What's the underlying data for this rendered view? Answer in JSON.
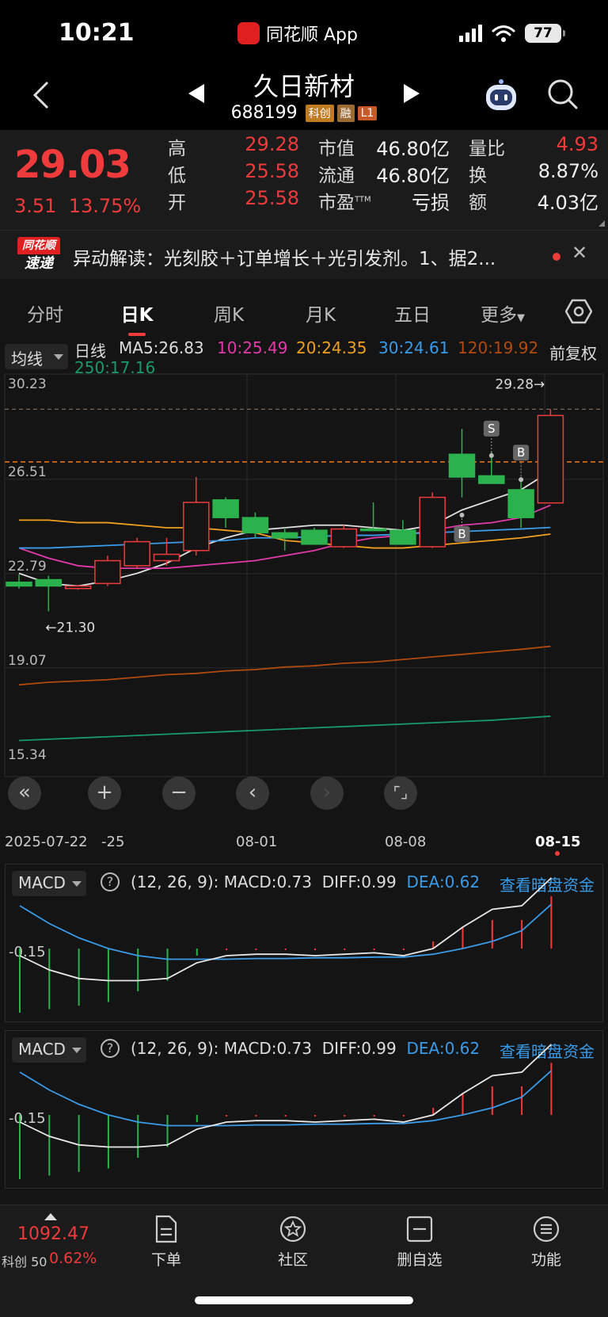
{
  "status_bar": {
    "time": "10:21",
    "app_name": "同花顺 App",
    "battery": "77"
  },
  "header": {
    "stock_name": "久日新材",
    "stock_code": "688199",
    "tags": [
      "科创",
      "融",
      "L1"
    ],
    "icons": [
      "back-icon",
      "prev-arrow-icon",
      "next-arrow-icon",
      "robot-assistant-icon",
      "search-icon"
    ]
  },
  "quote": {
    "price": "29.03",
    "change": "3.51",
    "change_pct": "13.75%",
    "high_label": "高",
    "high": "29.28",
    "low_label": "低",
    "low": "25.58",
    "open_label": "开",
    "open": "25.58",
    "mktcap_label": "市值",
    "mktcap": "46.80亿",
    "float_label": "流通",
    "float_cap": "46.80亿",
    "pe_label": "市盈",
    "pe_sup": "TTM",
    "pe": "亏损",
    "vol_ratio_label": "量比",
    "vol_ratio": "4.93",
    "turnover_label": "换",
    "turnover": "8.87%",
    "amount_label": "额",
    "amount": "4.03亿"
  },
  "news": {
    "logo_top": "同花顺",
    "logo_bottom": "速递",
    "text": "异动解读：光刻胶＋订单增长＋光引发剂。1、据2..."
  },
  "tabs": [
    "分时",
    "日K",
    "周K",
    "月K",
    "五日",
    "更多"
  ],
  "active_tab": 1,
  "chart_header": {
    "ma_select": "均线",
    "period": "日线",
    "ma5": "MA5:26.83",
    "ma10": "10:25.49",
    "ma20": "20:24.35",
    "ma30": "30:24.61",
    "ma120": "120:19.92",
    "ma250": "250:17.16",
    "adjust": "前复权"
  },
  "colors": {
    "up": "#ef3b3b",
    "down": "#2bb24c",
    "ma5": "#e0e0e0",
    "ma10": "#e23aa8",
    "ma20": "#f0a020",
    "ma30": "#3a9be8",
    "ma120": "#b04a10",
    "ma250": "#1a9a6a"
  },
  "chart_data": {
    "type": "candlestick",
    "y_ticks": [
      "30.23",
      "26.51",
      "22.79",
      "19.07",
      "15.34"
    ],
    "ylim": [
      15.34,
      30.23
    ],
    "x_labels": [
      "2025-07-22",
      "-25",
      "08-01",
      "08-08",
      "08-15"
    ],
    "annotations": {
      "high": "29.28→",
      "low": "←21.30"
    },
    "signal_marks": [
      "S",
      "B",
      "B"
    ],
    "candles": [
      {
        "o": 22.45,
        "h": 22.75,
        "l": 22.2,
        "c": 22.3
      },
      {
        "o": 22.55,
        "h": 22.7,
        "l": 21.3,
        "c": 22.3
      },
      {
        "o": 22.2,
        "h": 22.35,
        "l": 22.15,
        "c": 22.3
      },
      {
        "o": 22.4,
        "h": 23.5,
        "l": 22.3,
        "c": 23.3
      },
      {
        "o": 23.1,
        "h": 24.2,
        "l": 23.0,
        "c": 24.05
      },
      {
        "o": 23.3,
        "h": 24.2,
        "l": 23.1,
        "c": 23.55
      },
      {
        "o": 23.7,
        "h": 26.6,
        "l": 23.5,
        "c": 25.6
      },
      {
        "o": 25.7,
        "h": 25.8,
        "l": 24.6,
        "c": 25.0
      },
      {
        "o": 25.0,
        "h": 25.2,
        "l": 24.2,
        "c": 24.4
      },
      {
        "o": 24.4,
        "h": 24.6,
        "l": 23.7,
        "c": 24.2
      },
      {
        "o": 24.5,
        "h": 24.6,
        "l": 24.0,
        "c": 23.95
      },
      {
        "o": 23.85,
        "h": 24.7,
        "l": 23.8,
        "c": 24.55
      },
      {
        "o": 24.55,
        "h": 25.6,
        "l": 24.5,
        "c": 24.5
      },
      {
        "o": 24.5,
        "h": 24.9,
        "l": 24.1,
        "c": 23.95
      },
      {
        "o": 23.85,
        "h": 26.0,
        "l": 23.8,
        "c": 25.8
      },
      {
        "o": 27.5,
        "h": 28.5,
        "l": 25.8,
        "c": 26.6
      },
      {
        "o": 26.65,
        "h": 27.6,
        "l": 26.4,
        "c": 26.35
      },
      {
        "o": 26.1,
        "h": 26.6,
        "l": 24.6,
        "c": 25.0
      },
      {
        "o": 25.58,
        "h": 29.28,
        "l": 25.58,
        "c": 29.03
      }
    ],
    "series": [
      {
        "name": "MA5",
        "values": [
          22.8,
          22.4,
          22.3,
          22.5,
          22.8,
          23.2,
          23.8,
          24.2,
          24.5,
          24.6,
          24.7,
          24.7,
          24.6,
          24.5,
          24.7,
          25.3,
          25.7,
          26.1,
          26.83
        ]
      },
      {
        "name": "MA10",
        "values": [
          23.8,
          23.4,
          23.1,
          23.0,
          23.0,
          23.0,
          23.1,
          23.2,
          23.3,
          23.5,
          23.7,
          24.0,
          24.2,
          24.3,
          24.5,
          24.7,
          24.8,
          25.0,
          25.49
        ]
      },
      {
        "name": "MA20",
        "values": [
          24.9,
          24.9,
          24.8,
          24.8,
          24.7,
          24.6,
          24.6,
          24.5,
          24.4,
          24.1,
          24.0,
          23.9,
          23.8,
          23.8,
          23.9,
          24.0,
          24.1,
          24.2,
          24.35
        ]
      },
      {
        "name": "MA30",
        "values": [
          23.8,
          23.8,
          23.85,
          23.9,
          23.95,
          24.0,
          24.05,
          24.1,
          24.2,
          24.2,
          24.25,
          24.3,
          24.3,
          24.35,
          24.4,
          24.45,
          24.5,
          24.55,
          24.61
        ]
      },
      {
        "name": "MA120",
        "values": [
          18.4,
          18.5,
          18.55,
          18.6,
          18.7,
          18.8,
          18.85,
          18.95,
          19.0,
          19.1,
          19.15,
          19.25,
          19.3,
          19.4,
          19.5,
          19.6,
          19.7,
          19.8,
          19.92
        ]
      },
      {
        "name": "MA250",
        "values": [
          16.2,
          16.25,
          16.3,
          16.35,
          16.4,
          16.45,
          16.5,
          16.55,
          16.6,
          16.65,
          16.7,
          16.75,
          16.8,
          16.85,
          16.9,
          16.95,
          17.0,
          17.08,
          17.16
        ]
      }
    ],
    "macd": {
      "params": "(12, 26, 9)",
      "macd": "MACD:0.73",
      "diff": "DIFF:0.99",
      "dea": "DEA:0.62",
      "axis_label": "-0.15",
      "histogram": [
        -0.9,
        -0.85,
        -0.8,
        -0.75,
        -0.6,
        -0.45,
        -0.1,
        0.0,
        0.0,
        0.0,
        0.0,
        0.0,
        0.0,
        0.0,
        0.1,
        0.3,
        0.4,
        0.4,
        0.73
      ],
      "diff_values": [
        -0.1,
        -0.3,
        -0.42,
        -0.45,
        -0.45,
        -0.42,
        -0.2,
        -0.1,
        -0.08,
        -0.08,
        -0.1,
        -0.08,
        -0.06,
        -0.1,
        0.0,
        0.3,
        0.55,
        0.6,
        0.99
      ],
      "dea_values": [
        0.6,
        0.35,
        0.15,
        0.0,
        -0.1,
        -0.15,
        -0.15,
        -0.15,
        -0.14,
        -0.14,
        -0.13,
        -0.13,
        -0.12,
        -0.12,
        -0.08,
        0.0,
        0.1,
        0.25,
        0.62
      ]
    }
  },
  "controls": [
    "collapse-icon",
    "zoom-in-icon",
    "zoom-out-icon",
    "left-arrow-icon",
    "right-arrow-icon",
    "fullscreen-icon"
  ],
  "macd_panel": {
    "selector": "MACD",
    "help": "?",
    "link": "查看暗盘资金"
  },
  "bottom_nav": {
    "index_value": "1092.47",
    "index_name": "科创 50",
    "index_pct": "0.62%",
    "items": [
      "下单",
      "社区",
      "删自选",
      "功能"
    ]
  }
}
